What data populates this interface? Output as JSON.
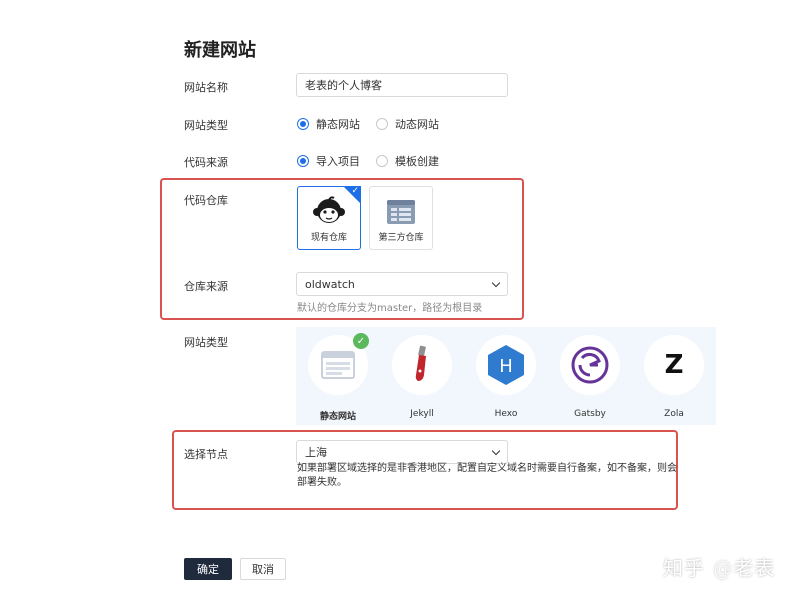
{
  "title": "新建网站",
  "site_name": {
    "label": "网站名称",
    "value": "老表的个人博客"
  },
  "site_type": {
    "label": "网站类型",
    "options": [
      "静态网站",
      "动态网站"
    ],
    "selected": "静态网站"
  },
  "code_source": {
    "label": "代码来源",
    "options": [
      "导入项目",
      "模板创建"
    ],
    "selected": "导入项目"
  },
  "code_repo": {
    "label": "代码仓库",
    "cards": [
      "现有仓库",
      "第三方仓库"
    ],
    "selected": "现有仓库"
  },
  "repo_source": {
    "label": "仓库来源",
    "value": "oldwatch",
    "hint": "默认的仓库分支为master，路径为根目录"
  },
  "framework": {
    "label": "网站类型",
    "cards": [
      "静态网站",
      "Jekyll",
      "Hexo",
      "Gatsby",
      "Zola"
    ],
    "selected": "静态网站",
    "hexo_letter": "H",
    "zola_letter": "Z"
  },
  "node": {
    "label": "选择节点",
    "value": "上海",
    "hint": "如果部署区域选择的是非香港地区，配置自定义域名时需要自行备案，如不备案，则会部署失败。"
  },
  "buttons": {
    "ok": "确定",
    "cancel": "取消"
  },
  "watermark": "知乎 @老表",
  "colors": {
    "accent": "#1e6ee8",
    "highlight_border": "#d9534f",
    "check_green": "#5cb85c",
    "primary_button": "#1f2a3c"
  }
}
